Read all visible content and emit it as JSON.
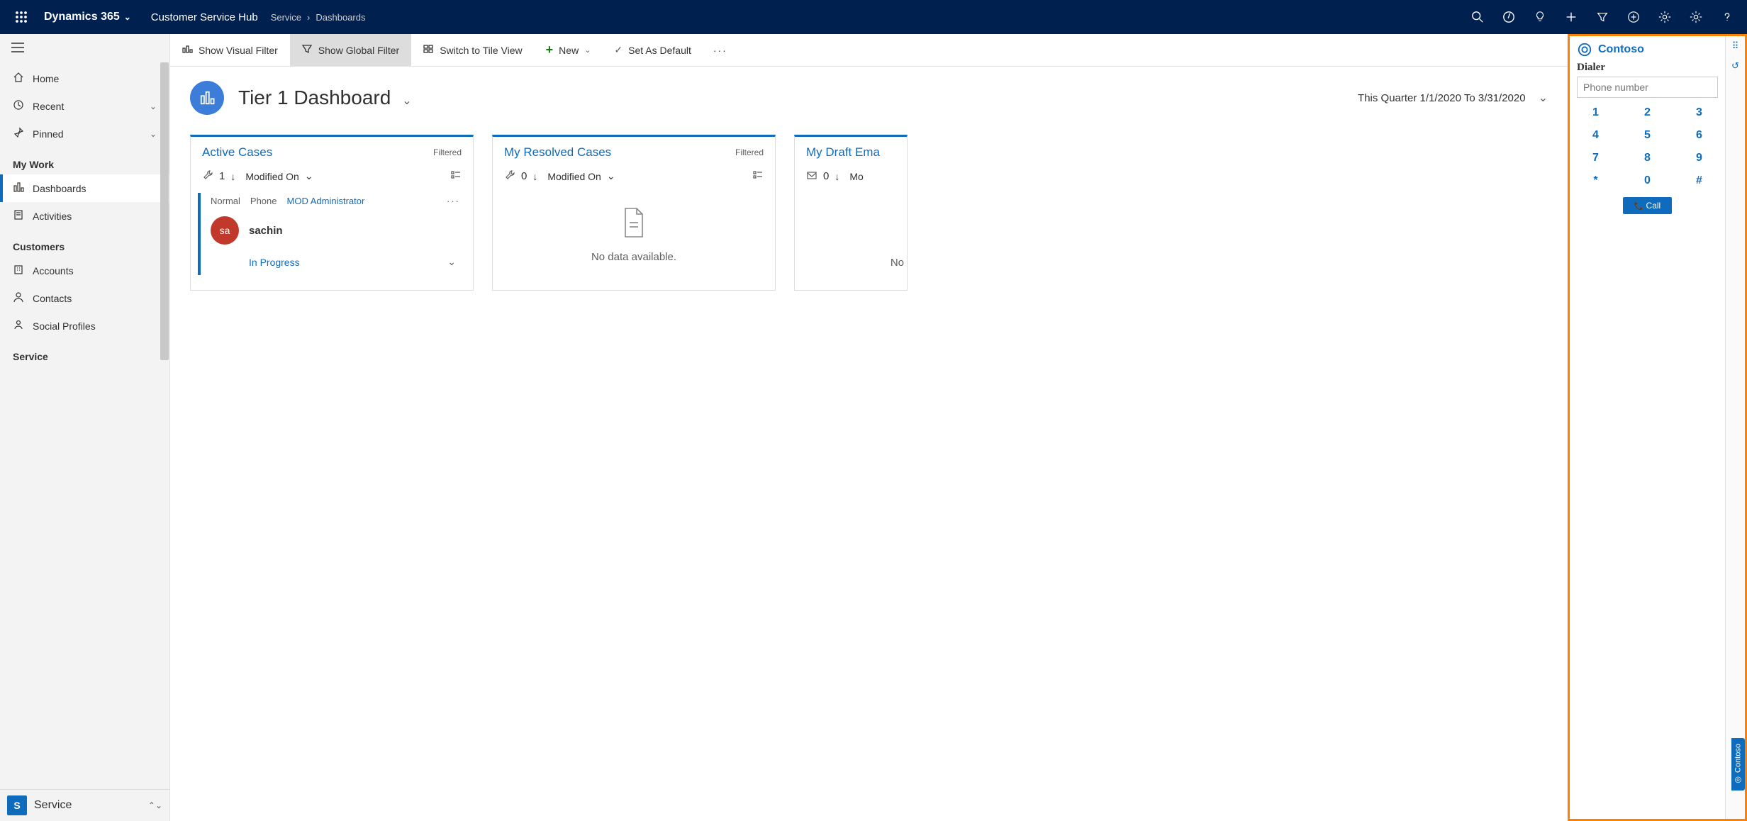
{
  "topbar": {
    "brand": "Dynamics 365",
    "app_name": "Customer Service Hub",
    "breadcrumb": [
      "Service",
      "Dashboards"
    ]
  },
  "sidebar": {
    "items": [
      {
        "label": "Home"
      },
      {
        "label": "Recent",
        "expandable": true
      },
      {
        "label": "Pinned",
        "expandable": true
      }
    ],
    "groups": [
      {
        "title": "My Work",
        "items": [
          {
            "label": "Dashboards",
            "active": true
          },
          {
            "label": "Activities"
          }
        ]
      },
      {
        "title": "Customers",
        "items": [
          {
            "label": "Accounts"
          },
          {
            "label": "Contacts"
          },
          {
            "label": "Social Profiles"
          }
        ]
      },
      {
        "title": "Service",
        "items": []
      }
    ],
    "area_switcher": {
      "badge": "S",
      "label": "Service"
    }
  },
  "commandbar": {
    "visual_filter": "Show Visual Filter",
    "global_filter": "Show Global Filter",
    "tile_view": "Switch to Tile View",
    "new": "New",
    "set_default": "Set As Default"
  },
  "dashboard": {
    "title": "Tier 1 Dashboard",
    "range": "This Quarter 1/1/2020 To 3/31/2020"
  },
  "cards": {
    "active": {
      "title": "Active Cases",
      "filtered": "Filtered",
      "count": "1",
      "sort": "Modified On",
      "item": {
        "priority": "Normal",
        "origin": "Phone",
        "owner": "MOD Administrator",
        "avatar": "sa",
        "name": "sachin",
        "status": "In Progress"
      }
    },
    "resolved": {
      "title": "My Resolved Cases",
      "filtered": "Filtered",
      "count": "0",
      "sort": "Modified On",
      "empty": "No data available."
    },
    "draft": {
      "title": "My Draft Ema",
      "count": "0",
      "sort": "Mo",
      "empty": "No"
    }
  },
  "dialer": {
    "brand": "Contoso",
    "heading": "Dialer",
    "placeholder": "Phone number",
    "keys": [
      "1",
      "2",
      "3",
      "4",
      "5",
      "6",
      "7",
      "8",
      "9",
      "*",
      "0",
      "#"
    ],
    "call": "Call",
    "tab_label": "Contoso"
  }
}
